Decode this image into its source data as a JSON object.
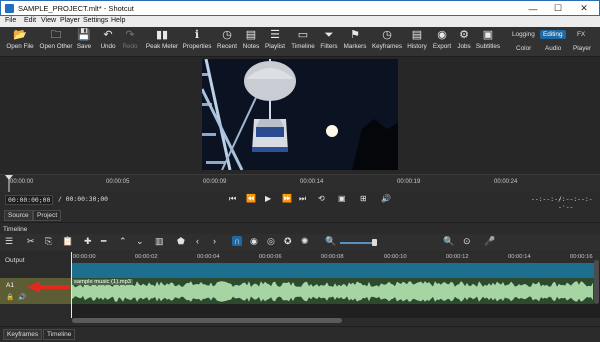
{
  "window": {
    "title": "SAMPLE_PROJECT.mlt* - Shotcut",
    "minimize_glyph": "—",
    "maximize_glyph": "☐",
    "close_glyph": "✕"
  },
  "menu": [
    "File",
    "Edit",
    "View",
    "Player",
    "Settings",
    "Help"
  ],
  "toolbar": [
    {
      "label": "Open File",
      "icon": "folder-icon",
      "glyph": "📂"
    },
    {
      "label": "Open Other",
      "icon": "folder-plus-icon",
      "glyph": "🗀"
    },
    {
      "label": "Save",
      "icon": "save-icon",
      "glyph": "💾"
    },
    {
      "label": "Undo",
      "icon": "undo-icon",
      "glyph": "↶"
    },
    {
      "label": "Redo",
      "icon": "redo-icon",
      "glyph": "↷"
    },
    {
      "label": "Peak Meter",
      "icon": "meter-icon",
      "glyph": "▮▮"
    },
    {
      "label": "Properties",
      "icon": "info-icon",
      "glyph": "ℹ"
    },
    {
      "label": "Recent",
      "icon": "clock-icon",
      "glyph": "◷"
    },
    {
      "label": "Notes",
      "icon": "notes-icon",
      "glyph": "▤"
    },
    {
      "label": "Playlist",
      "icon": "playlist-icon",
      "glyph": "☰"
    },
    {
      "label": "Timeline",
      "icon": "timeline-icon",
      "glyph": "▭"
    },
    {
      "label": "Filters",
      "icon": "filter-icon",
      "glyph": "⏷"
    },
    {
      "label": "Markers",
      "icon": "marker-icon",
      "glyph": "⚑"
    },
    {
      "label": "Keyframes",
      "icon": "keyframe-icon",
      "glyph": "◷"
    },
    {
      "label": "History",
      "icon": "history-icon",
      "glyph": "▤"
    },
    {
      "label": "Export",
      "icon": "export-icon",
      "glyph": "◉"
    },
    {
      "label": "Jobs",
      "icon": "gear-icon",
      "glyph": "⚙"
    },
    {
      "label": "Subtitles",
      "icon": "subtitles-icon",
      "glyph": "▣"
    }
  ],
  "layouts": {
    "logging": "Logging",
    "editing": "Editing",
    "fx": "FX",
    "color": "Color",
    "audio": "Audio",
    "player": "Player"
  },
  "viewer_ruler": [
    "00:00:00",
    "00:00:05",
    "00:00:09",
    "00:00:14",
    "00:00:19",
    "00:00:24"
  ],
  "transport": {
    "position": "00:00:00;00",
    "duration": "/ 00:00:30;00",
    "in_point": "--:--:--:--",
    "out_point": "/ --:--:--:--"
  },
  "source_tabs": {
    "source": "Source",
    "project": "Project"
  },
  "timeline": {
    "panel_title": "Timeline",
    "ruler": [
      "00:00:00",
      "00:00:02",
      "00:00:04",
      "00:00:06",
      "00:00:08",
      "00:00:10",
      "00:00:12",
      "00:00:14",
      "00:00:16"
    ],
    "output_label": "Output",
    "track_label": "A1",
    "clip_label": "sample music (1).mp3"
  },
  "bottom_tabs": {
    "keyframes": "Keyframes",
    "timeline": "Timeline"
  },
  "colors": {
    "accent": "#1f6aa5",
    "output_strip": "#1d6e8f",
    "waveform": "#a7d4a3",
    "arrow": "#e5281c"
  }
}
